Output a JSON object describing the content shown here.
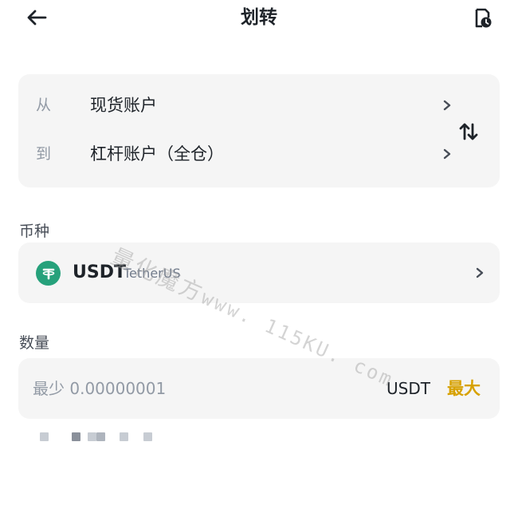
{
  "header": {
    "title": "划转"
  },
  "transfer": {
    "from_label": "从",
    "from_value": "现货账户",
    "to_label": "到",
    "to_value": "杠杆账户（全仓）"
  },
  "coin": {
    "section_label": "币种",
    "symbol": "USDT",
    "name": "TetherUS"
  },
  "amount": {
    "section_label": "数量",
    "placeholder": "最少 0.00000001",
    "unit": "USDT",
    "max_label": "最大"
  },
  "watermark": {
    "cn": "量化魔方",
    "url": "www. 115KU. com"
  },
  "colors": {
    "accent": "#d7a100",
    "tether": "#26a17b",
    "card_bg": "#f5f5f5",
    "muted": "#929aa5"
  }
}
